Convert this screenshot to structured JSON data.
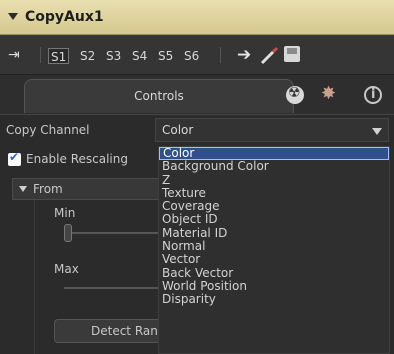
{
  "title_bar": {
    "title": "CopyAux1"
  },
  "view_bar": {
    "slots": [
      "S1",
      "S2",
      "S3",
      "S4",
      "S5",
      "S6"
    ],
    "active_slot": "S1"
  },
  "tabs": {
    "controls_label": "Controls"
  },
  "copy_channel": {
    "label": "Copy Channel",
    "value": "Color"
  },
  "enable_rescaling": {
    "label": "Enable Rescaling",
    "checked": true
  },
  "from_group": {
    "label": "From"
  },
  "min": {
    "label": "Min"
  },
  "max": {
    "label": "Max"
  },
  "detect_button": {
    "label": "Detect Range"
  },
  "dropdown": {
    "items": [
      "Color",
      "Background Color",
      "Z",
      "Texture",
      "Coverage",
      "Object ID",
      "Material ID",
      "Normal",
      "Vector",
      "Back Vector",
      "World Position",
      "Disparity"
    ],
    "selected_index": 0
  }
}
